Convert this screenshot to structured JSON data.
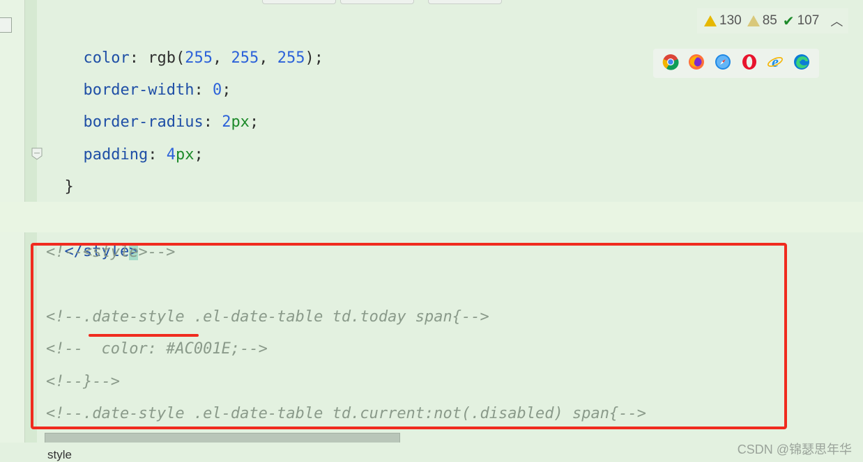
{
  "editor": {
    "lines": [
      {
        "prop": "color",
        "value_prefix": " rgb(",
        "nums": [
          "255",
          "255",
          "255"
        ],
        "value_suffix": ");"
      },
      {
        "prop": "border-width",
        "num": "0",
        "unit": "",
        "end": ";"
      },
      {
        "prop": "border-radius",
        "num": "2",
        "unit": "px",
        "end": ";"
      },
      {
        "prop": "padding",
        "num": "4",
        "unit": "px",
        "end": ";"
      }
    ],
    "closing_brace": "}",
    "style_close_tag": "</style",
    "style_close_bracket": ">",
    "comments": [
      "<!--<style>-->",
      "<!--.date-style .el-date-table td.today span{-->",
      "<!--  color: #AC001E;-->",
      "<!--}-->",
      "<!--.date-style .el-date-table td.current:not(.disabled) span{-->"
    ]
  },
  "inspections": {
    "warnings": "130",
    "weak_warnings": "85",
    "typos": "107"
  },
  "browsers": [
    "chrome-icon",
    "firefox-icon",
    "safari-icon",
    "opera-icon",
    "ie-icon",
    "edge-icon"
  ],
  "breadcrumb": "style",
  "watermark": "CSDN @锦瑟思年华",
  "colors": {
    "background": "#e3f1e0",
    "highlight": "#f02b1f"
  }
}
